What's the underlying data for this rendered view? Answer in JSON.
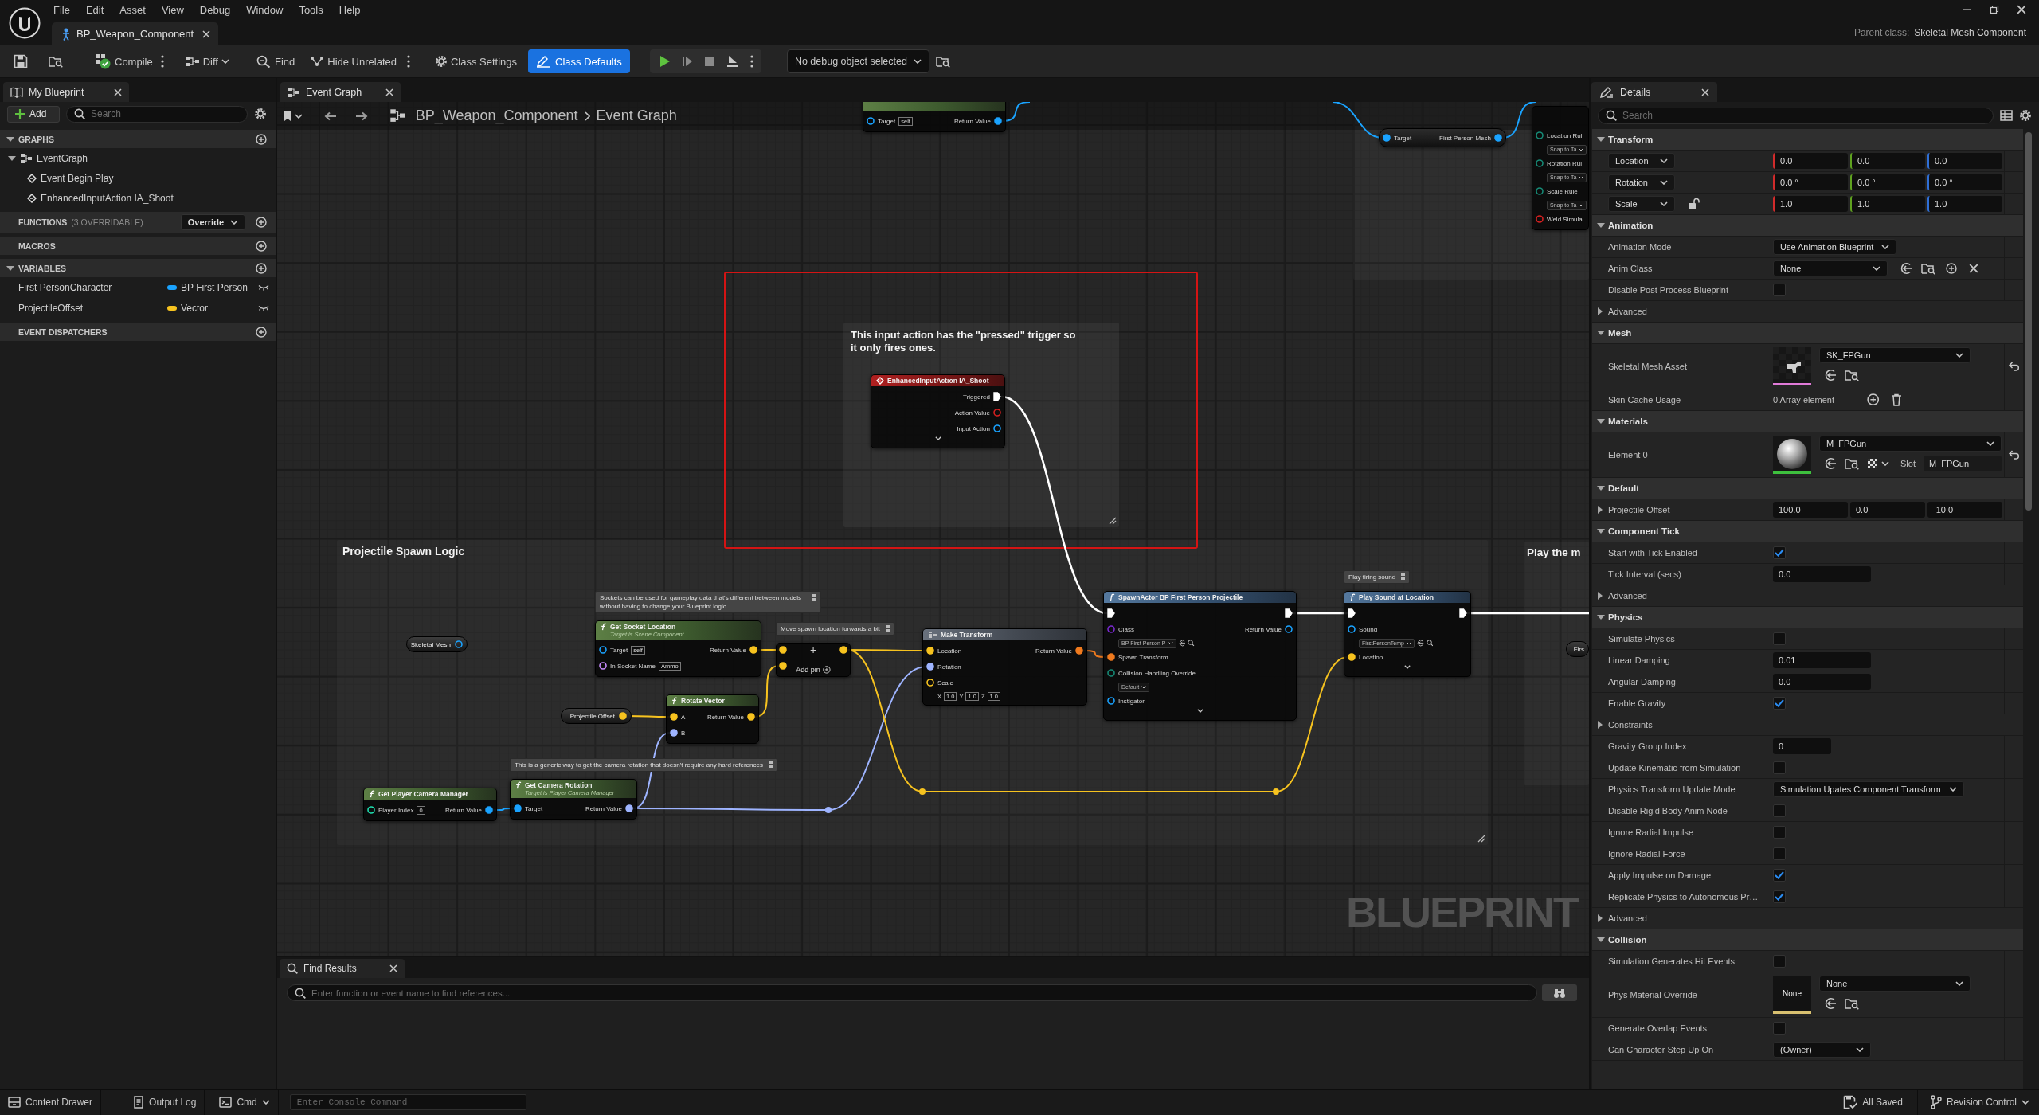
{
  "window": {
    "menu": [
      "File",
      "Edit",
      "Asset",
      "View",
      "Debug",
      "Window",
      "Tools",
      "Help"
    ],
    "document_tab": "BP_Weapon_Component",
    "parent_class_label": "Parent class:",
    "parent_class": "Skeletal Mesh Component"
  },
  "toolbar": {
    "compile": "Compile",
    "diff": "Diff",
    "find": "Find",
    "hide_unrelated": "Hide Unrelated",
    "class_settings": "Class Settings",
    "class_defaults": {
      "label": "Class Defaults",
      "active": true
    },
    "debug_object": "No debug object selected"
  },
  "my_blueprint": {
    "tab": "My Blueprint",
    "add_button": "Add",
    "search": {
      "placeholder": "Search"
    },
    "sections": [
      {
        "title": "GRAPHS",
        "items": [
          {
            "label": "EventGraph",
            "kind": "graph",
            "expanded": true,
            "children": [
              {
                "label": "Event Begin Play",
                "kind": "event"
              },
              {
                "label": "EnhancedInputAction IA_Shoot",
                "kind": "event"
              }
            ]
          }
        ]
      },
      {
        "title": "FUNCTIONS",
        "note": "(3 OVERRIDABLE)",
        "dropdown": "Override"
      },
      {
        "title": "MACROS"
      },
      {
        "title": "VARIABLES",
        "variables": [
          {
            "name": "First PersonCharacter",
            "type": "BP First Person",
            "color": "#1aa3ff"
          },
          {
            "name": "ProjectileOffset",
            "type": "Vector",
            "color": "#f7c31f"
          }
        ]
      },
      {
        "title": "EVENT DISPATCHERS"
      }
    ]
  },
  "graph": {
    "tab": "Event Graph",
    "breadcrumb": [
      "BP_Weapon_Component",
      "Event Graph"
    ],
    "comments": [
      {
        "title": "This input action has the \"pressed\" trigger so it only fires ones."
      },
      {
        "title": "Projectile Spawn Logic"
      },
      {
        "title": "Play the m"
      }
    ],
    "nodes": [
      {
        "kind": "pure",
        "inputs": [
          {
            "label": "Target",
            "kind": "object",
            "connected": false,
            "field": "self"
          }
        ],
        "outputs": [
          {
            "label": "Return Value",
            "kind": "object",
            "connected": true
          }
        ]
      },
      {
        "kind": "compact",
        "inputs": [
          {
            "label": "Target",
            "kind": "object",
            "connected": true
          }
        ],
        "outputs": [
          {
            "label": "First Person Mesh",
            "kind": "object",
            "connected": true
          }
        ]
      },
      {
        "kind": "function",
        "inputs": [
          {
            "label": "Location Rul",
            "kind": "enum",
            "connected": false,
            "dropdown": "Snap to Ta"
          },
          {
            "label": "Rotation Rul",
            "kind": "enum",
            "connected": false,
            "dropdown": "Snap to Ta"
          },
          {
            "label": "Scale Rule",
            "kind": "enum",
            "connected": false,
            "dropdown": "Snap to Ta"
          },
          {
            "label": "Weld Simula",
            "kind": "bool",
            "connected": false
          }
        ]
      },
      {
        "kind": "event",
        "title": "EnhancedInputAction IA_Shoot",
        "outputs": [
          {
            "label": "Triggered",
            "kind": "exec",
            "connected": true
          },
          {
            "label": "Action Value",
            "kind": "bool",
            "connected": false
          },
          {
            "label": "Input Action",
            "kind": "object",
            "connected": false
          }
        ],
        "advanced": true
      },
      {
        "kind": "variable",
        "title": "Skeletal Mesh",
        "outputs": [
          {
            "kind": "object",
            "connected": false
          }
        ]
      },
      {
        "kind": "pure",
        "title": "Get Socket Location",
        "subtitle": "Target is Scene Component",
        "note": "Sockets can be used for gameplay data that's different between models without having to change your Blueprint logic",
        "inputs": [
          {
            "label": "Target",
            "kind": "object",
            "connected": false,
            "field": "self"
          },
          {
            "label": "In Socket Name",
            "kind": "name",
            "connected": false,
            "field": "Ammo"
          }
        ],
        "outputs": [
          {
            "label": "Return Value",
            "kind": "vector",
            "connected": true
          }
        ]
      },
      {
        "kind": "operator",
        "symbol": "+",
        "add_pin": "Add pin",
        "note": "Move spawn location forwards a bit",
        "inputs": [
          {
            "kind": "vector",
            "connected": true
          },
          {
            "kind": "vector",
            "connected": true
          }
        ],
        "outputs": [
          {
            "kind": "vector",
            "connected": true
          }
        ]
      },
      {
        "kind": "struct",
        "title": "Make Transform",
        "inputs": [
          {
            "label": "Location",
            "kind": "vector",
            "connected": true
          },
          {
            "label": "Rotation",
            "kind": "rotator",
            "connected": true
          },
          {
            "label": "Scale",
            "kind": "vector",
            "connected": false,
            "fields": [
              {
                "axis": "X",
                "value": "1.0"
              },
              {
                "axis": "Y",
                "value": "1.0"
              },
              {
                "axis": "Z",
                "value": "1.0"
              }
            ]
          }
        ],
        "outputs": [
          {
            "label": "Return Value",
            "kind": "transform",
            "connected": true
          }
        ]
      },
      {
        "kind": "function",
        "title": "SpawnActor BP First Person Projectile",
        "inputs": [
          {
            "kind": "exec",
            "connected": true
          },
          {
            "label": "Class",
            "kind": "class",
            "connected": false,
            "dropdown": "BP First Person P"
          },
          {
            "label": "Spawn Transform",
            "kind": "transform",
            "connected": true
          },
          {
            "label": "Collision Handling Override",
            "kind": "enum",
            "connected": false,
            "dropdown": "Default"
          },
          {
            "label": "Instigator",
            "kind": "object",
            "connected": false
          }
        ],
        "outputs": [
          {
            "kind": "exec",
            "connected": true
          },
          {
            "label": "Return Value",
            "kind": "object",
            "connected": false
          }
        ],
        "advanced": true
      },
      {
        "kind": "function",
        "title": "Play Sound at Location",
        "note": "Play firing sound",
        "inputs": [
          {
            "kind": "exec",
            "connected": true
          },
          {
            "label": "Sound",
            "kind": "object",
            "connected": false,
            "dropdown": "FirstPersonTemp"
          },
          {
            "label": "Location",
            "kind": "vector",
            "connected": true
          }
        ],
        "outputs": [
          {
            "kind": "exec",
            "connected": true
          }
        ],
        "advanced": true
      },
      {
        "kind": "variable",
        "title": "Firs"
      },
      {
        "kind": "variable",
        "title": "Projectile Offset",
        "outputs": [
          {
            "kind": "vector",
            "connected": true
          }
        ]
      },
      {
        "kind": "pure",
        "title": "Rotate Vector",
        "inputs": [
          {
            "label": "A",
            "kind": "vector",
            "connected": true
          },
          {
            "label": "B",
            "kind": "rotator",
            "connected": true
          }
        ],
        "outputs": [
          {
            "label": "Return Value",
            "kind": "vector",
            "connected": true
          }
        ]
      },
      {
        "kind": "pure",
        "title": "Get Player Camera Manager",
        "inputs": [
          {
            "label": "Player Index",
            "kind": "int",
            "connected": false,
            "field": "0"
          }
        ],
        "outputs": [
          {
            "label": "Return Value",
            "kind": "object",
            "connected": true
          }
        ]
      },
      {
        "kind": "pure",
        "title": "Get Camera Rotation",
        "subtitle": "Target is Player Camera Manager",
        "note": "This is a generic way to get the camera rotation that doesn't require any hard references",
        "inputs": [
          {
            "label": "Target",
            "kind": "object",
            "connected": true
          }
        ],
        "outputs": [
          {
            "label": "Return Value",
            "kind": "rotator",
            "connected": true
          }
        ]
      }
    ],
    "graph_type_label": "BLUEPRINT"
  },
  "find_results": {
    "tab": "Find Results",
    "search": {
      "placeholder": "Enter function or event name to find references..."
    }
  },
  "details": {
    "tab": "Details",
    "search": {
      "placeholder": "Search"
    },
    "sections": [
      {
        "title": "Transform",
        "expanded": true,
        "rows": [
          {
            "kind": "transform",
            "label": "Location",
            "values": [
              "0.0",
              "0.0",
              "0.0"
            ]
          },
          {
            "kind": "transform",
            "label": "Rotation",
            "values": [
              "0.0 °",
              "0.0 °",
              "0.0 °"
            ]
          },
          {
            "kind": "transform",
            "label": "Scale",
            "locked": false,
            "values": [
              "1.0",
              "1.0",
              "1.0"
            ]
          }
        ]
      },
      {
        "title": "Animation",
        "expanded": true,
        "rows": [
          {
            "kind": "dropdown",
            "label": "Animation Mode",
            "value": "Use Animation Blueprint"
          },
          {
            "kind": "class_picker",
            "label": "Anim Class",
            "value": "None"
          },
          {
            "kind": "checkbox",
            "label": "Disable Post Process Blueprint",
            "checked": false
          },
          {
            "kind": "group",
            "label": "Advanced",
            "expanded": false
          }
        ]
      },
      {
        "title": "Mesh",
        "expanded": true,
        "rows": [
          {
            "kind": "skeletal_mesh",
            "label": "Skeletal Mesh Asset",
            "value": "SK_FPGun",
            "modified": true
          },
          {
            "kind": "array",
            "label": "Skin Cache Usage",
            "value": "0 Array element"
          }
        ]
      },
      {
        "title": "Materials",
        "expanded": true,
        "rows": [
          {
            "kind": "material",
            "label": "Element 0",
            "value": "M_FPGun",
            "slot_label": "Slot",
            "slot": "M_FPGun",
            "modified": true
          }
        ]
      },
      {
        "title": "Default",
        "expanded": true,
        "rows": [
          {
            "kind": "vector",
            "label": "Projectile Offset",
            "expanded": false,
            "values": [
              "100.0",
              "0.0",
              "-10.0"
            ]
          }
        ]
      },
      {
        "title": "Component Tick",
        "expanded": true,
        "rows": [
          {
            "kind": "checkbox",
            "label": "Start with Tick Enabled",
            "checked": true
          },
          {
            "kind": "number",
            "label": "Tick Interval (secs)",
            "value": "0.0"
          },
          {
            "kind": "group",
            "label": "Advanced",
            "expanded": false
          }
        ]
      },
      {
        "title": "Physics",
        "expanded": true,
        "rows": [
          {
            "kind": "checkbox",
            "label": "Simulate Physics",
            "checked": false
          },
          {
            "kind": "number",
            "label": "Linear Damping",
            "value": "0.01"
          },
          {
            "kind": "number",
            "label": "Angular Damping",
            "value": "0.0"
          },
          {
            "kind": "checkbox",
            "label": "Enable Gravity",
            "checked": true
          },
          {
            "kind": "group",
            "label": "Constraints",
            "expanded": false
          },
          {
            "kind": "integer",
            "label": "Gravity Group Index",
            "value": "0"
          },
          {
            "kind": "checkbox",
            "label": "Update Kinematic from Simulation",
            "checked": false
          },
          {
            "kind": "dropdown",
            "label": "Physics Transform Update Mode",
            "value": "Simulation Upates Component Transform"
          },
          {
            "kind": "checkbox",
            "label": "Disable Rigid Body Anim Node",
            "checked": false
          },
          {
            "kind": "checkbox",
            "label": "Ignore Radial Impulse",
            "checked": false
          },
          {
            "kind": "checkbox",
            "label": "Ignore Radial Force",
            "checked": false
          },
          {
            "kind": "checkbox",
            "label": "Apply Impulse on Damage",
            "checked": true
          },
          {
            "kind": "checkbox",
            "label": "Replicate Physics to Autonomous Pr…",
            "checked": true
          },
          {
            "kind": "group",
            "label": "Advanced",
            "expanded": false
          }
        ]
      },
      {
        "title": "Collision",
        "expanded": true,
        "rows": [
          {
            "kind": "checkbox",
            "label": "Simulation Generates Hit Events",
            "checked": false
          },
          {
            "kind": "physical_material",
            "label": "Phys Material Override",
            "thumbnail_label": "None",
            "value": "None"
          },
          {
            "kind": "checkbox",
            "label": "Generate Overlap Events",
            "checked": false
          },
          {
            "kind": "dropdown",
            "label": "Can Character Step Up On",
            "value": "(Owner)"
          }
        ]
      }
    ]
  },
  "status_bar": {
    "content_drawer": "Content Drawer",
    "output_log": "Output Log",
    "cmd": "Cmd",
    "console": {
      "placeholder": "Enter Console Command"
    },
    "save_state": "All Saved",
    "revision_control": "Revision Control"
  }
}
